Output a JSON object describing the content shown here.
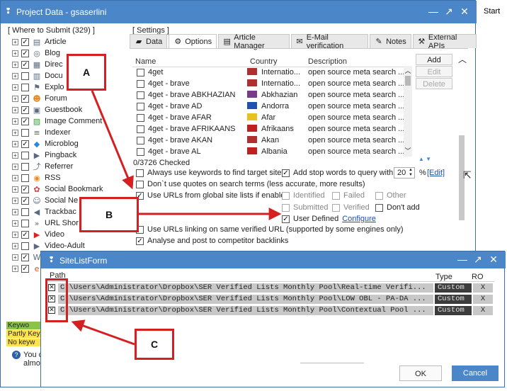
{
  "main": {
    "title": "Project Data - gsaserlini",
    "start_label": "Start",
    "controls": {
      "minimize": "—",
      "maximize": "↗",
      "close": "✕"
    }
  },
  "left": {
    "header": "[ Where to Submit  (329) ]",
    "items": [
      {
        "label": "Article",
        "checked": true,
        "icon": "article-icon"
      },
      {
        "label": "Blog",
        "checked": true,
        "icon": "blog-icon"
      },
      {
        "label": "Direc",
        "checked": true,
        "icon": "directory-icon"
      },
      {
        "label": "Docu",
        "checked": false,
        "icon": "document-icon"
      },
      {
        "label": "Explo",
        "checked": false,
        "icon": "exploit-icon"
      },
      {
        "label": "Forum",
        "checked": true,
        "icon": "forum-icon"
      },
      {
        "label": "Guestbook",
        "checked": true,
        "icon": "guestbook-icon"
      },
      {
        "label": "Image Comment",
        "checked": true,
        "icon": "image-icon"
      },
      {
        "label": "Indexer",
        "checked": false,
        "icon": "indexer-icon"
      },
      {
        "label": "Microblog",
        "checked": true,
        "icon": "microblog-icon"
      },
      {
        "label": "Pingback",
        "checked": false,
        "icon": "pingback-icon"
      },
      {
        "label": "Referrer",
        "checked": false,
        "icon": "referrer-icon"
      },
      {
        "label": "RSS",
        "checked": false,
        "icon": "rss-icon"
      },
      {
        "label": "Social Bookmark",
        "checked": true,
        "icon": "social-bookmark-icon"
      },
      {
        "label": "Social Ne",
        "checked": true,
        "icon": "social-network-icon"
      },
      {
        "label": "Trackbac",
        "checked": false,
        "icon": "trackback-icon"
      },
      {
        "label": "URL Shor",
        "checked": false,
        "icon": "url-shortener-icon"
      },
      {
        "label": "Video",
        "checked": true,
        "icon": "video-icon"
      },
      {
        "label": "Video-Adult",
        "checked": false,
        "icon": "video-adult-icon"
      },
      {
        "label": "W",
        "checked": true,
        "icon": "wiki-icon"
      },
      {
        "label": "W",
        "checked": true,
        "icon": "web2-icon"
      }
    ],
    "keyword_bars": [
      {
        "label": "Keywo",
        "color": "#8bc34a"
      },
      {
        "label": "Partly Key",
        "color": "#ffe14d"
      },
      {
        "label": "No keyw",
        "color": "#ffe14d"
      }
    ],
    "help_text": {
      "line1": "You c",
      "line2": "almos"
    }
  },
  "settings": {
    "header": "[ Settings ]",
    "tabs": [
      {
        "label": "Data",
        "icon": "data-icon",
        "active": false
      },
      {
        "label": "Options",
        "icon": "gear-icon",
        "active": true
      },
      {
        "label": "Article Manager",
        "icon": "article-manager-icon",
        "active": false
      },
      {
        "label": "E-Mail verification",
        "icon": "email-icon",
        "active": false
      },
      {
        "label": "Notes",
        "icon": "notes-icon",
        "active": false
      },
      {
        "label": "External APIs",
        "icon": "external-api-icon",
        "active": false
      }
    ],
    "columns": {
      "name": "Name",
      "country": "Country",
      "description": "Description"
    },
    "engines": [
      {
        "name": "4get",
        "country": "Internatio...",
        "description": "open source meta search ..."
      },
      {
        "name": "4get - brave",
        "country": "Internatio...",
        "description": "open source meta search ..."
      },
      {
        "name": "4get - brave ABKHAZIAN",
        "country": "Abkhazian",
        "description": "open source meta search ..."
      },
      {
        "name": "4get - brave AD",
        "country": "Andorra",
        "description": "open source meta search ..."
      },
      {
        "name": "4get - brave AFAR",
        "country": "Afar",
        "description": "open source meta search ..."
      },
      {
        "name": "4get - brave AFRIKAANS",
        "country": "Afrikaans",
        "description": "open source meta search ..."
      },
      {
        "name": "4get - brave AKAN",
        "country": "Akan",
        "description": "open source meta search ..."
      },
      {
        "name": "4get - brave AL",
        "country": "Albania",
        "description": "open source meta search ..."
      }
    ],
    "buttons": {
      "add": "Add",
      "edit": "Edit",
      "delete": "Delete"
    },
    "checked_count": "0/3726 Checked",
    "options": {
      "always_keywords": "Always use keywords to find target sites",
      "add_stop_words": "Add stop words to query with",
      "stop_words_value": "20",
      "percent": "%",
      "edit_link": "[Edit]",
      "no_quotes": "Don`t use quotes on search terms (less accurate, more results)",
      "use_global_lists": "Use URLs from global site lists if enabled",
      "identified": "Identified",
      "failed": "Failed",
      "other": "Other",
      "submitted": "Submitted",
      "verified": "Verified",
      "dont_add": "Don't add",
      "user_defined": "User Defined",
      "configure": "Configure",
      "linking_same": "Use URLs linking on same verified URL (supported by some engines only)",
      "analyse": "Analyse and post to competitor backlinks"
    }
  },
  "dialog": {
    "title": "SiteListForm",
    "controls": {
      "minimize": "—",
      "maximize": "↗",
      "close": "✕"
    },
    "columns": {
      "path": "Path",
      "type": "Type",
      "ro": "RO"
    },
    "rows": [
      {
        "path": "C:\\Users\\Administrator\\Dropbox\\SER Verified Lists Monthly Pool\\Real-time Verifi...",
        "type": "Custom",
        "ro": "X"
      },
      {
        "path": "C:\\Users\\Administrator\\Dropbox\\SER Verified Lists Monthly Pool\\LOW OBL - PA-DA ...",
        "type": "Custom",
        "ro": "X"
      },
      {
        "path": "C:\\Users\\Administrator\\Dropbox\\SER Verified Lists Monthly Pool\\Contextual Pool ...",
        "type": "Custom",
        "ro": "X"
      }
    ],
    "ok": "OK",
    "cancel": "Cancel"
  },
  "annotations": {
    "a": "A",
    "b": "B",
    "c": "C",
    "color": "#d42020"
  }
}
